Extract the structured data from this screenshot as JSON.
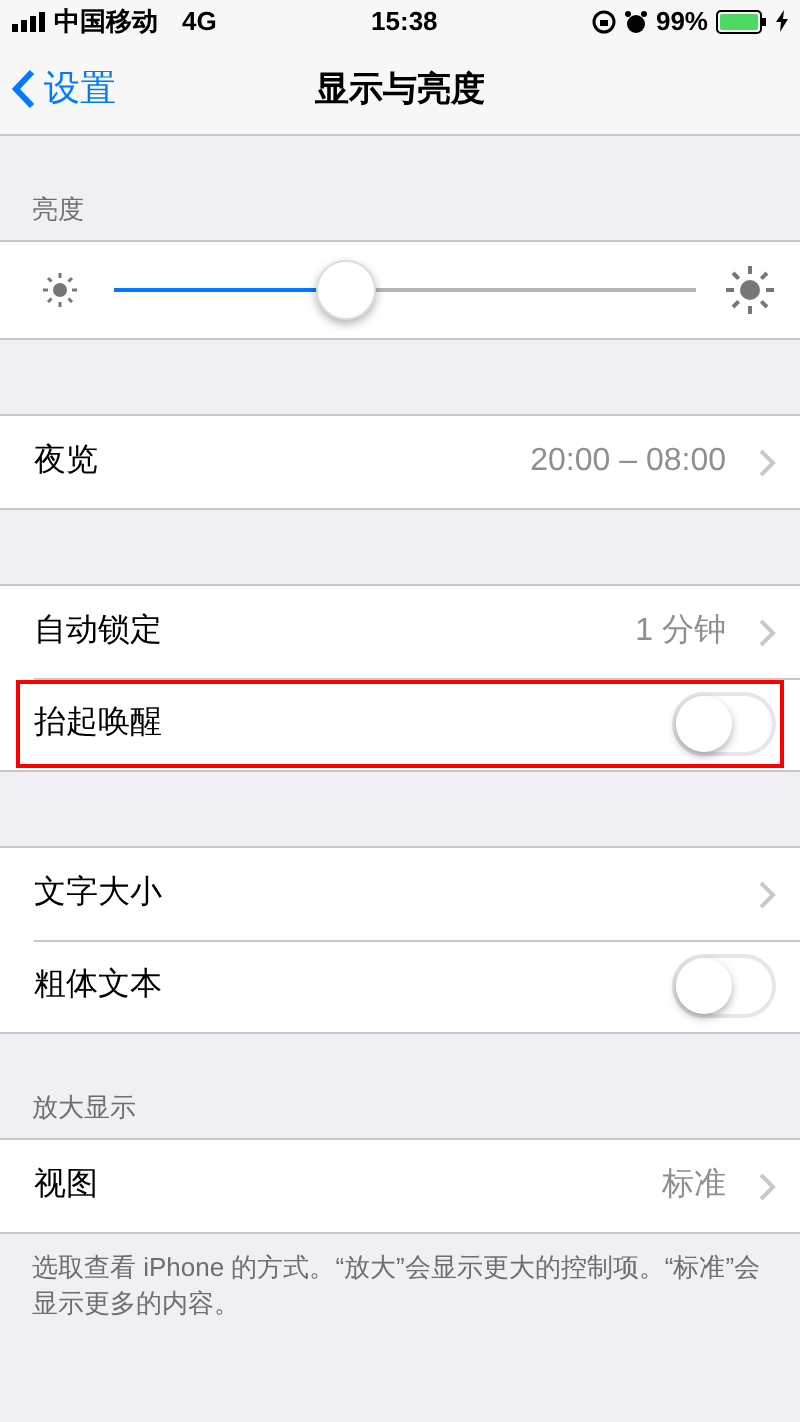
{
  "status_bar": {
    "carrier": "中国移动",
    "network": "4G",
    "time": "15:38",
    "battery": "99%"
  },
  "nav": {
    "back": "设置",
    "title": "显示与亮度"
  },
  "groups": [
    {
      "header": "亮度",
      "rows": [
        {
          "kind": "slider",
          "level": 0.4
        }
      ]
    },
    {
      "rows": [
        {
          "kind": "value",
          "label": "夜览",
          "value": "20:00 – 08:00"
        }
      ]
    },
    {
      "rows": [
        {
          "kind": "value",
          "label": "自动锁定",
          "value": "1 分钟"
        },
        {
          "kind": "toggle",
          "label": "抬起唤醒",
          "on": false,
          "highlighted": true
        }
      ]
    },
    {
      "rows": [
        {
          "kind": "value",
          "label": "文字大小"
        },
        {
          "kind": "toggle",
          "label": "粗体文本",
          "on": false
        }
      ]
    },
    {
      "header": "放大显示",
      "rows": [
        {
          "kind": "value",
          "label": "视图",
          "value": "标准"
        }
      ],
      "footer": "选取查看 iPhone 的方式。“放大”会显示更大的控制项。“标准”会显示更多的内容。"
    }
  ]
}
